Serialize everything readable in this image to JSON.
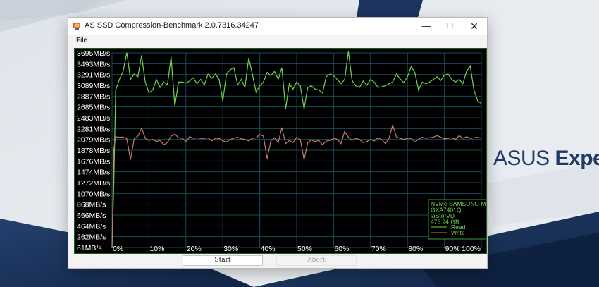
{
  "window": {
    "title": "AS SSD Compression-Benchmark 2.0.7316.34247",
    "minimize_glyph": "—",
    "maximize_glyph": "☐",
    "close_glyph": "✕"
  },
  "menu": {
    "file_label": "File"
  },
  "buttons": {
    "start_label": "Start",
    "abort_label": "Abort"
  },
  "desktop": {
    "brand_regular": "ASUS ",
    "brand_bold": "Expe"
  },
  "chart_data": {
    "type": "line",
    "y_tick_labels": [
      "3695MB/s",
      "3493MB/s",
      "3291MB/s",
      "3089MB/s",
      "2887MB/s",
      "2685MB/s",
      "2483MB/s",
      "2281MB/s",
      "2079MB/s",
      "1878MB/s",
      "1676MB/s",
      "1474MB/s",
      "1272MB/s",
      "1070MB/s",
      "868MB/s",
      "666MB/s",
      "464MB/s",
      "262MB/s",
      "61MB/s"
    ],
    "ylim": [
      61,
      3695
    ],
    "x_tick_labels": [
      "0%",
      "10%",
      "20%",
      "30%",
      "40%",
      "50%",
      "60%",
      "70%",
      "80%",
      "90%",
      "100%"
    ],
    "xlim": [
      0,
      100
    ],
    "grid": true,
    "legend": {
      "placement": "bottom-right",
      "drive_lines": [
        "NVMe SAMSUNG M",
        "GXA7401Q",
        "iaStorVD",
        "476.94 GB"
      ],
      "read_label": "Read",
      "write_label": "Write"
    },
    "colors": {
      "read": "#74d34a",
      "write": "#c77a72",
      "grid": "#164a5a",
      "legend_text": "#74d34a",
      "legend_border": "#3a9a3a"
    },
    "series": [
      {
        "name": "Read",
        "x": [
          0,
          0.5,
          1,
          2,
          3,
          4,
          5,
          6,
          7,
          8,
          9,
          10,
          11,
          12,
          13,
          14,
          15,
          16,
          17,
          18,
          19,
          20,
          21,
          22,
          23,
          24,
          25,
          26,
          27,
          28,
          29,
          30,
          31,
          32,
          33,
          34,
          35,
          36,
          37,
          38,
          39,
          40,
          41,
          42,
          43,
          44,
          45,
          46,
          47,
          48,
          49,
          50,
          51,
          52,
          53,
          54,
          55,
          56,
          57,
          58,
          59,
          60,
          61,
          62,
          63,
          64,
          65,
          66,
          67,
          68,
          69,
          70,
          71,
          72,
          73,
          74,
          75,
          76,
          77,
          78,
          79,
          80,
          81,
          82,
          83,
          84,
          85,
          86,
          87,
          88,
          89,
          90,
          91,
          92,
          93,
          94,
          95,
          96,
          97,
          98,
          99,
          100
        ],
        "y": [
          61,
          1300,
          3000,
          3200,
          3350,
          3700,
          3200,
          3300,
          3250,
          3650,
          3150,
          2950,
          3000,
          3200,
          3050,
          3150,
          3100,
          3620,
          2700,
          3150,
          3150,
          3130,
          3170,
          3230,
          3120,
          3200,
          3100,
          3300,
          3220,
          3300,
          3200,
          2800,
          3300,
          3380,
          3420,
          3100,
          3200,
          3050,
          3600,
          3300,
          2960,
          3080,
          3150,
          3330,
          3270,
          3350,
          3200,
          3420,
          2650,
          3120,
          3020,
          3150,
          3080,
          2650,
          3050,
          3080,
          3020,
          3000,
          2950,
          3250,
          3300,
          3270,
          3200,
          3120,
          3200,
          3720,
          3180,
          3080,
          3050,
          3170,
          3090,
          3200,
          3150,
          3050,
          3060,
          3080,
          3120,
          3150,
          3300,
          3210,
          3140,
          3250,
          3440,
          3330,
          3000,
          3150,
          3120,
          3150,
          3200,
          3250,
          3180,
          3280,
          3300,
          3200,
          3150,
          3200,
          3120,
          3350,
          3450,
          3000,
          2800,
          2750
        ]
      },
      {
        "name": "Write",
        "x": [
          0,
          0.5,
          1,
          2,
          3,
          4,
          5,
          6,
          7,
          8,
          9,
          10,
          11,
          12,
          13,
          14,
          15,
          16,
          17,
          18,
          19,
          20,
          21,
          22,
          23,
          24,
          25,
          26,
          27,
          28,
          29,
          30,
          31,
          32,
          33,
          34,
          35,
          36,
          37,
          38,
          39,
          40,
          41,
          42,
          43,
          44,
          45,
          46,
          47,
          48,
          49,
          50,
          51,
          52,
          53,
          54,
          55,
          56,
          57,
          58,
          59,
          60,
          61,
          62,
          63,
          64,
          65,
          66,
          67,
          68,
          69,
          70,
          71,
          72,
          73,
          74,
          75,
          76,
          77,
          78,
          79,
          80,
          81,
          82,
          83,
          84,
          85,
          86,
          87,
          88,
          89,
          90,
          91,
          92,
          93,
          94,
          95,
          96,
          97,
          98,
          99,
          100
        ],
        "y": [
          61,
          1900,
          2130,
          2120,
          2125,
          2090,
          1700,
          2090,
          2140,
          2290,
          2100,
          2060,
          2080,
          2040,
          2060,
          1980,
          2020,
          2140,
          2180,
          2110,
          2100,
          2040,
          2130,
          2100,
          2110,
          2100,
          2100,
          2110,
          2050,
          2100,
          2100,
          2050,
          2030,
          2080,
          2100,
          2120,
          2090,
          2080,
          2050,
          2100,
          2110,
          2170,
          2140,
          1720,
          2050,
          2110,
          2020,
          2300,
          2000,
          2060,
          2020,
          2120,
          2080,
          1700,
          2020,
          2070,
          2040,
          2060,
          1980,
          2050,
          2060,
          2100,
          2080,
          2000,
          2230,
          2120,
          2060,
          2100,
          2080,
          2020,
          2040,
          2080,
          2050,
          2110,
          2080,
          2000,
          2100,
          2350,
          2130,
          2100,
          2080,
          2100,
          2100,
          2030,
          2080,
          2120,
          2100,
          2110,
          2120,
          2150,
          2120,
          2090,
          2100,
          2110,
          2080,
          2150,
          2100,
          2130,
          2100,
          2110,
          2120,
          2100
        ]
      }
    ]
  }
}
